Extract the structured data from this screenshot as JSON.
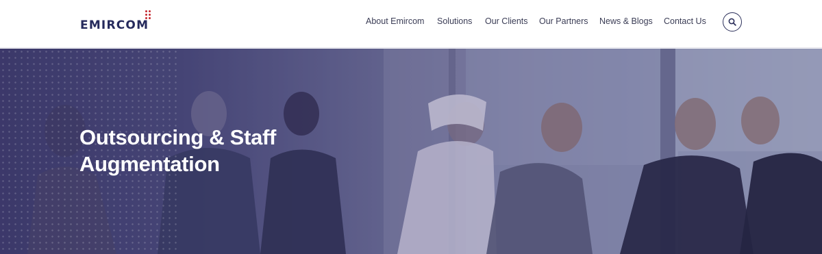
{
  "header": {
    "logo_text": "EMIRCOM",
    "nav": [
      {
        "label": "About Emircom"
      },
      {
        "label": "Solutions"
      },
      {
        "label": "Our Clients"
      },
      {
        "label": "Our Partners"
      },
      {
        "label": "News & Blogs"
      },
      {
        "label": "Contact Us"
      }
    ],
    "search_icon": "search-icon"
  },
  "hero": {
    "title_line1": "Outsourcing & Staff",
    "title_line2": "Augmentation"
  },
  "colors": {
    "brand_navy": "#252a5c",
    "brand_red": "#c4262e",
    "hero_overlay": "#4a4a78"
  }
}
